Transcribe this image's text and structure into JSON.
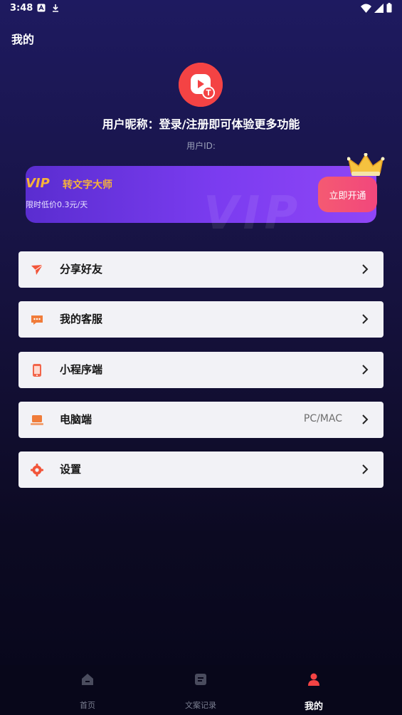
{
  "status_bar": {
    "time": "3:48"
  },
  "page": {
    "title": "我的"
  },
  "profile": {
    "nickname": "用户昵称：登录/注册即可体验更多功能",
    "user_id_label": "用户ID:"
  },
  "vip": {
    "badge": "VIP",
    "title": "转文字大师",
    "subtitle": "限时低价0.3元/天",
    "button_label": "立即开通",
    "watermark": "VIP"
  },
  "menu": [
    {
      "label": "分享好友",
      "icon": "paper-plane-icon",
      "extra": ""
    },
    {
      "label": "我的客服",
      "icon": "chat-bubble-icon",
      "extra": ""
    },
    {
      "label": "小程序端",
      "icon": "phone-icon",
      "extra": ""
    },
    {
      "label": "电脑端",
      "icon": "laptop-icon",
      "extra": "PC/MAC"
    },
    {
      "label": "设置",
      "icon": "gear-icon",
      "extra": ""
    }
  ],
  "tabbar": [
    {
      "label": "首页",
      "icon": "home-icon",
      "active": false
    },
    {
      "label": "文案记录",
      "icon": "document-icon",
      "active": false
    },
    {
      "label": "我的",
      "icon": "person-icon",
      "active": true
    }
  ],
  "colors": {
    "accent": "#f44344",
    "vip_gold": "#f6b23a",
    "button_pink": "#f2477c",
    "menu_bg": "#f2f2f6"
  }
}
